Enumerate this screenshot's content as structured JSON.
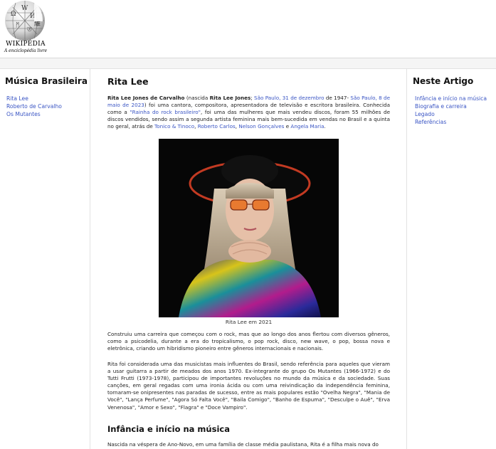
{
  "header": {
    "logo_word": "WIKIPÉDIA",
    "logo_tagline": "A enciclopédia livre"
  },
  "left_sidebar": {
    "title": "Música Brasileira",
    "items": [
      {
        "label": "Rita Lee"
      },
      {
        "label": "Roberto de Carvalho"
      },
      {
        "label": "Os Mutantes"
      }
    ]
  },
  "right_sidebar": {
    "title": "Neste Artigo",
    "items": [
      {
        "label": "Infância e início na música"
      },
      {
        "label": "Biografia e carreira"
      },
      {
        "label": "Legado"
      },
      {
        "label": "Referências"
      }
    ]
  },
  "article": {
    "title": "Rita Lee",
    "intro": {
      "name_full": "Rita Lee Jones de Carvalho",
      "born_prefix": " (nascida ",
      "birth_name": "Rita Lee Jones",
      "sep": "; ",
      "birth_place_date": "São Paulo, 31 de dezembro",
      "birth_year": " de 1947- ",
      "death_place_date": "São Paulo, 8 de maio de 2023",
      "text1": ") foi uma cantora, compositora, apresentadora de televisão e escritora brasileira. Conhecida como a ",
      "nickname": "\"Rainha do rock brasileiro\"",
      "text2": ", foi uma das mulheres que mais vendeu discos, foram 55 milhões de discos vendidos, sendo assim a segunda artista feminina mais bem-sucedida em vendas no Brasil e a quinta no geral, atrás de ",
      "artist1": "Tonico & Tinoco",
      "comma1": ", ",
      "artist2": "Roberto Carlos",
      "comma2": ", ",
      "artist3": "Nelson Gonçalves",
      "and": " e ",
      "artist4": "Angela Maria",
      "end": "."
    },
    "image_caption": "Rita Lee em 2021",
    "para2": "Construiu uma carreira que começou com o rock, mas que ao longo dos anos flertou com diversos gêneros, como a psicodelia, durante a era do tropicalismo, o pop rock, disco, new wave, o pop, bossa nova e eletrônica, criando um hibridismo pioneiro entre gêneros internacionais e nacionais.",
    "para3": "Rita foi considerada uma das musicistas mais influentes do Brasil, sendo referência para aqueles que vieram a usar guitarra a partir de meados dos anos 1970. Ex-integrante do grupo Os Mutantes (1966-1972) e do Tutti Frutti (1973-1978), participou de importantes revoluções no mundo da música e da sociedade. Suas canções, em geral regadas com uma ironia ácida ou com uma reivindicação da independência feminina, tornaram-se onipresentes nas paradas de sucesso, entre as mais populares estão \"Ovelha Negra\", \"Mania de Você\", \"Lança Perfume\", \"Agora Só Falta Você\", \"Baila Comigo\", \"Banho de Espuma\", \"Desculpe o Auê\", \"Erva Venenosa\", \"Amor e Sexo\", \"Flagra\" e \"Doce Vampiro\".",
    "section1_title": "Infância e início na música",
    "para4": "Nascida na véspera de Ano-Novo, em uma família de classe média paulistana, Rita é a filha mais nova do"
  },
  "colors": {
    "link": "#3a55c4",
    "text": "#222222",
    "border": "#e2e2e2"
  }
}
